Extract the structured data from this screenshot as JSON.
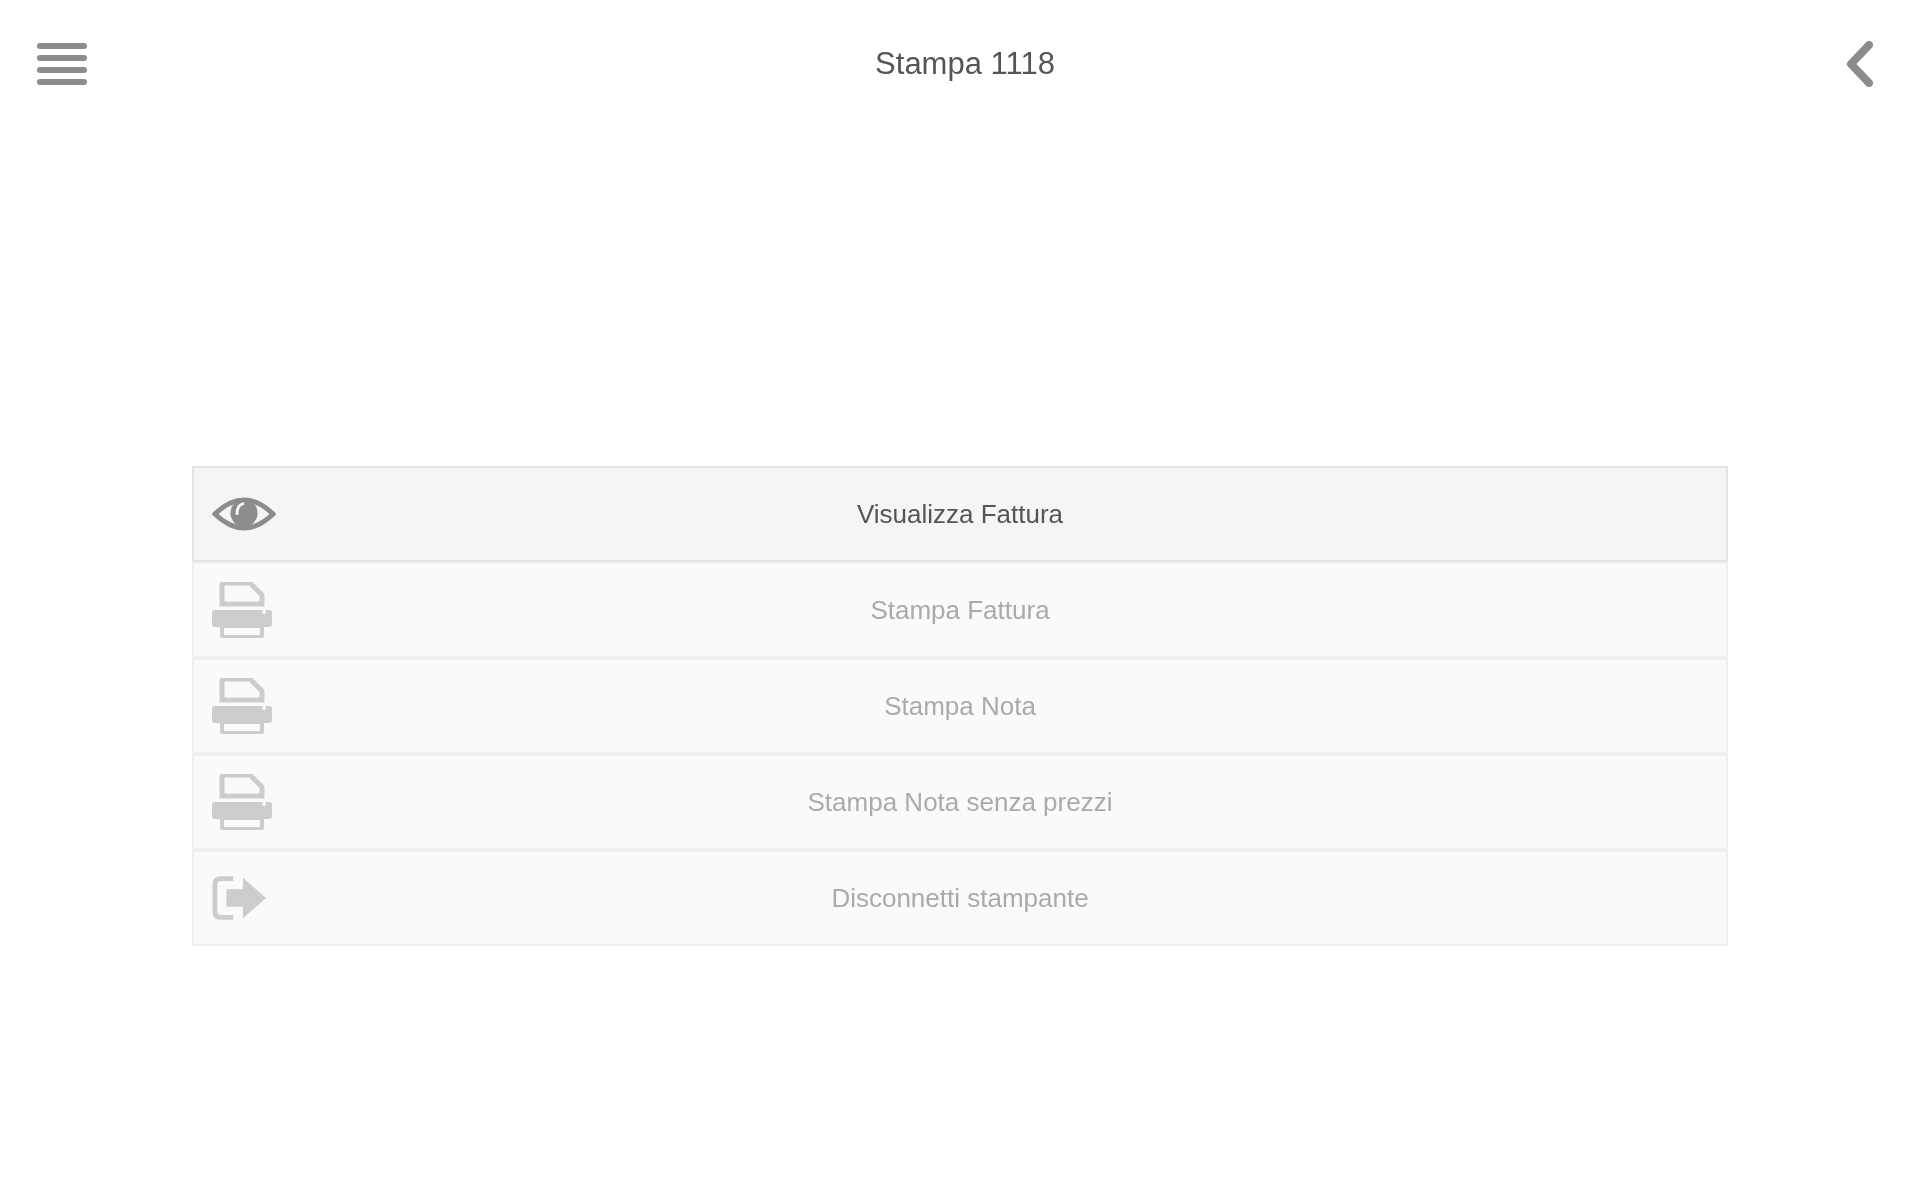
{
  "header": {
    "title": "Stampa 1118"
  },
  "actions": [
    {
      "label": "Visualizza Fattura",
      "kind": "eye",
      "disabled": false
    },
    {
      "label": "Stampa Fattura",
      "kind": "printer",
      "disabled": true
    },
    {
      "label": "Stampa Nota",
      "kind": "printer",
      "disabled": true
    },
    {
      "label": "Stampa Nota senza prezzi",
      "kind": "printer",
      "disabled": true
    },
    {
      "label": "Disconnetti stampante",
      "kind": "exit",
      "disabled": true
    }
  ]
}
